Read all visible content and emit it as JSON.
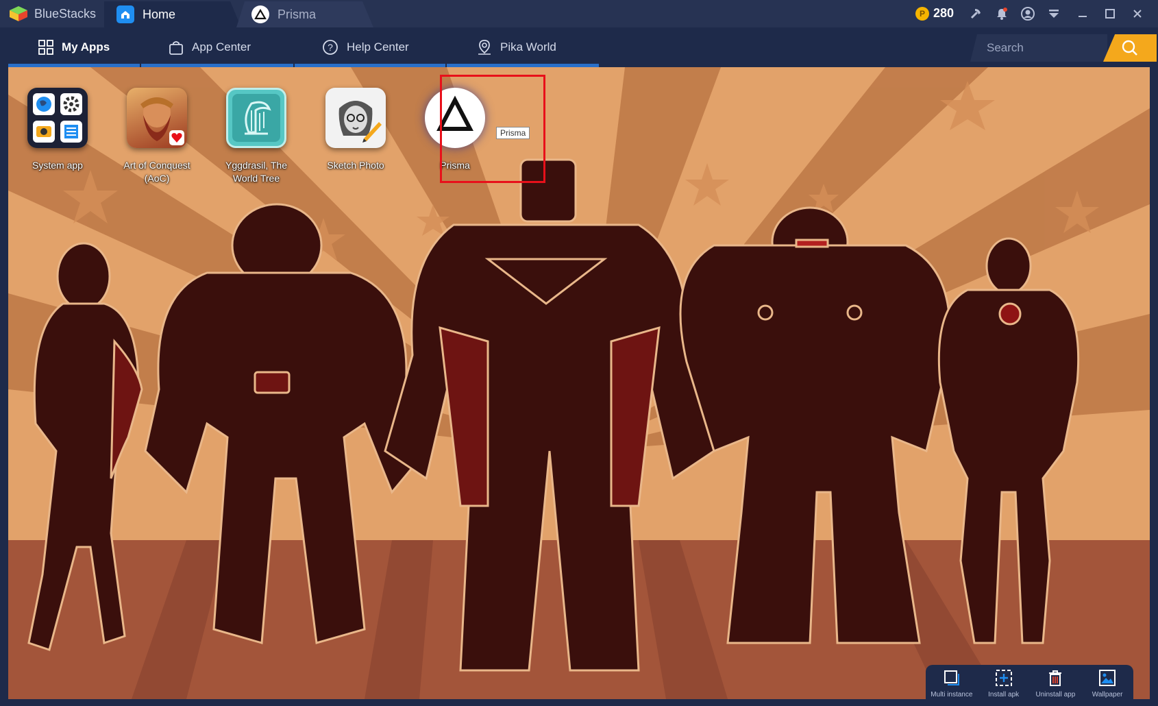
{
  "titlebar": {
    "brand": "BlueStacks",
    "tabs": [
      {
        "label": "Home",
        "icon": "home-icon"
      },
      {
        "label": "Prisma",
        "icon": "prisma-icon"
      }
    ],
    "coins": "280",
    "icons": [
      "pickaxe-icon",
      "bell-icon",
      "account-icon",
      "menu-icon",
      "minimize-icon",
      "maximize-icon",
      "close-icon"
    ]
  },
  "nav": {
    "tabs": [
      {
        "label": "My Apps",
        "icon": "grid-icon",
        "active": true
      },
      {
        "label": "App Center",
        "icon": "bag-icon",
        "active": false
      },
      {
        "label": "Help Center",
        "icon": "help-icon",
        "active": false
      },
      {
        "label": "Pika World",
        "icon": "map-pin-icon",
        "active": false
      }
    ],
    "search_placeholder": "Search"
  },
  "apps": [
    {
      "label": "System app",
      "icon": "system-app-icon"
    },
    {
      "label": "Art of Conquest (AoC)",
      "icon": "art-of-conquest-icon"
    },
    {
      "label": "Yggdrasil, The World Tree",
      "icon": "yggdrasil-icon"
    },
    {
      "label": "Sketch Photo",
      "icon": "sketch-photo-icon"
    },
    {
      "label": "Prisma",
      "icon": "prisma-app-icon"
    }
  ],
  "tooltip": "Prisma",
  "dock": [
    {
      "label": "Multi instance",
      "icon": "multi-instance-icon"
    },
    {
      "label": "Install apk",
      "icon": "install-apk-icon"
    },
    {
      "label": "Uninstall app",
      "icon": "uninstall-app-icon"
    },
    {
      "label": "Wallpaper",
      "icon": "wallpaper-icon"
    }
  ],
  "colors": {
    "titlebar": "#273353",
    "navbar": "#1e2a4a",
    "accent": "#2a6fc8",
    "search_button": "#f4a81c",
    "highlight": "#e8101a",
    "wallpaper_light": "#e2a26a",
    "wallpaper_dark": "#b5703f",
    "silhouette": "#3a0f0c"
  }
}
